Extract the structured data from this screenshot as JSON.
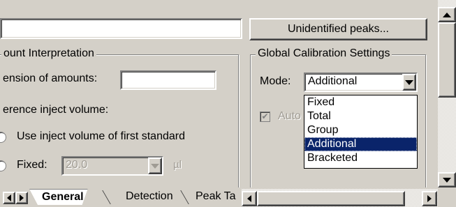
{
  "top": {
    "text_field_value": "",
    "unidentified_button_label": "Unidentified peaks..."
  },
  "amount": {
    "title": "ount Interpretation",
    "dimension_label": "ension of amounts:",
    "dimension_value": "",
    "reference_label": "erence inject volume:",
    "option_first_standard": "Use inject volume of first standard",
    "option_fixed": "Fixed:",
    "fixed_value": "20.0",
    "fixed_unit": "µl"
  },
  "calibration": {
    "title": "Global Calibration Settings",
    "mode_label": "Mode:",
    "mode_selected": "Additional",
    "auto_label": "Auto",
    "options": [
      "Fixed",
      "Total",
      "Group",
      "Additional",
      "Bracketed"
    ],
    "selected_index": 3
  },
  "tabs": [
    {
      "label": "General",
      "active": true
    },
    {
      "label": "Detection",
      "active": false
    },
    {
      "label": "Peak Ta",
      "active": false
    }
  ],
  "icons": {
    "scroll_up": "triangle-up",
    "scroll_down": "triangle-down",
    "scroll_left": "triangle-left",
    "scroll_right": "triangle-right",
    "dropdown": "triangle-down"
  }
}
